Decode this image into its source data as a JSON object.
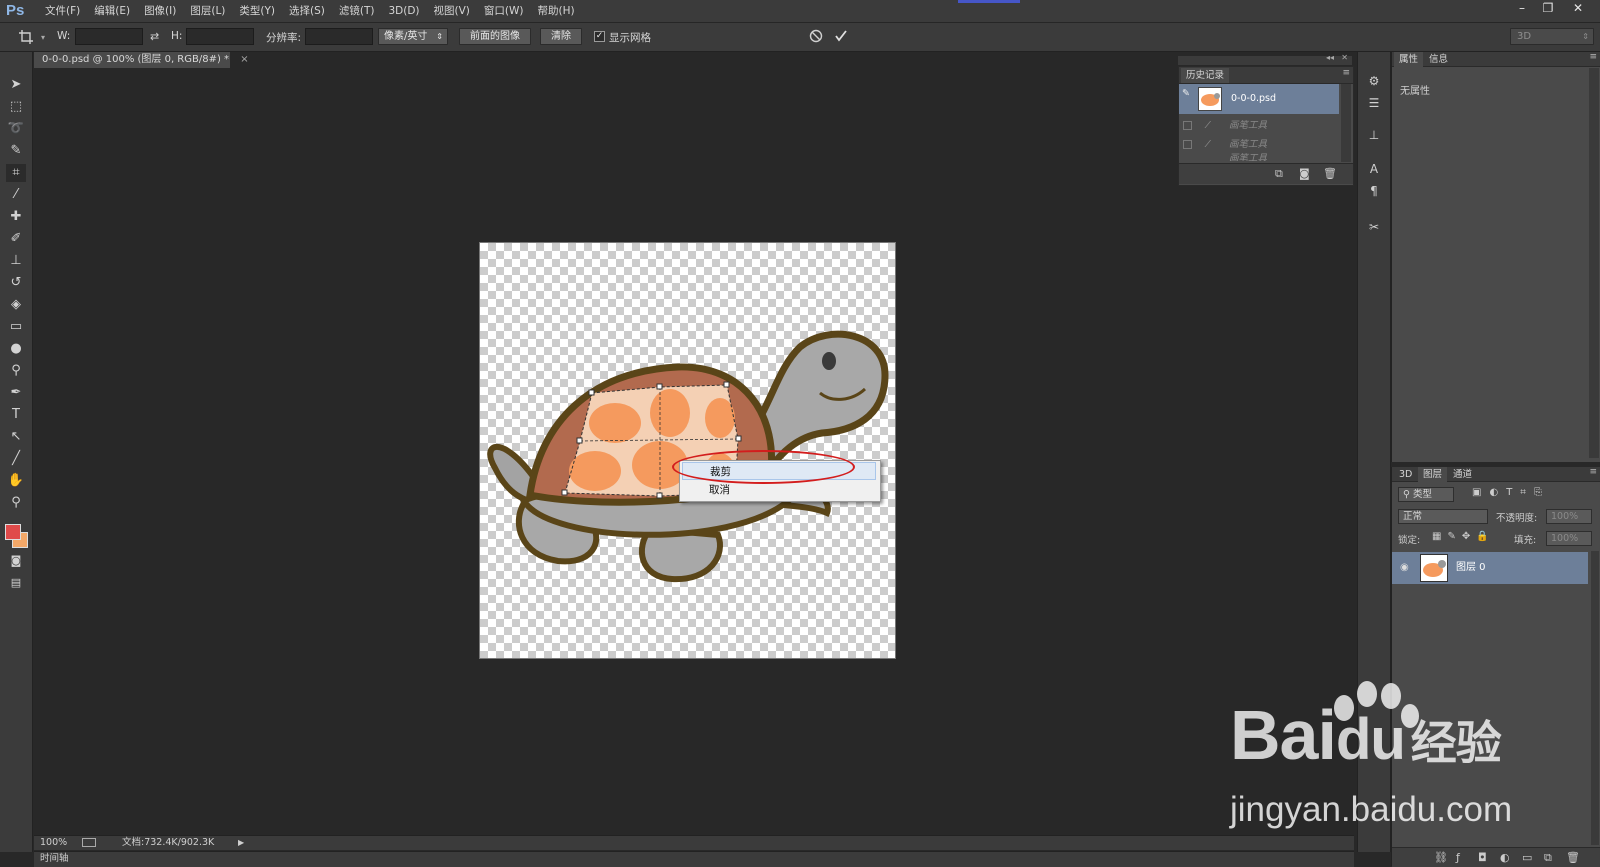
{
  "app": {
    "logo": "Ps"
  },
  "menubar": {
    "items": [
      "文件(F)",
      "编辑(E)",
      "图像(I)",
      "图层(L)",
      "类型(Y)",
      "选择(S)",
      "滤镜(T)",
      "3D(D)",
      "视图(V)",
      "窗口(W)",
      "帮助(H)"
    ]
  },
  "window_controls": {
    "minimize": "–",
    "restore": "❐",
    "close": "✕"
  },
  "options": {
    "w_label": "W:",
    "h_label": "H:",
    "resolution_label": "分辨率:",
    "unit_select": "像素/英寸",
    "front_image_button": "前面的图像",
    "clear_button": "清除",
    "show_grid_label": "显示网格",
    "show_grid_checked": true,
    "workspace_select": "3D"
  },
  "document": {
    "tab_title": "0-0-0.psd @ 100% (图层 0, RGB/8#) *",
    "tab_close": "×"
  },
  "context_menu": {
    "items": [
      "裁剪",
      "取消"
    ],
    "highlight_color": "#d31d1d"
  },
  "status": {
    "zoom": "100%",
    "doc_size": "文档:732.4K/902.3K",
    "timeline_label": "时间轴"
  },
  "history_panel": {
    "tab_label": "历史记录",
    "snapshot_name": "0-0-0.psd",
    "steps": [
      "画笔工具",
      "画笔工具",
      "画笔工具"
    ]
  },
  "properties_panel": {
    "tabs": [
      "属性",
      "信息"
    ],
    "content": "无属性"
  },
  "layers_panel": {
    "tabs": [
      "3D",
      "图层",
      "通道"
    ],
    "filter_label": "类型",
    "blend_mode": "正常",
    "opacity_label": "不透明度:",
    "opacity_value": "100%",
    "lock_label": "锁定:",
    "fill_label": "填充:",
    "fill_value": "100%",
    "layers": [
      {
        "name": "图层 0"
      }
    ]
  },
  "watermark": {
    "brand": "Bai",
    "brand_suffix": "du",
    "brand_cn": "经验",
    "url": "jingyan.baidu.com"
  },
  "colors": {
    "foreground": "#e04a4a",
    "background": "#f4a868",
    "selection": "#6d7f99"
  }
}
